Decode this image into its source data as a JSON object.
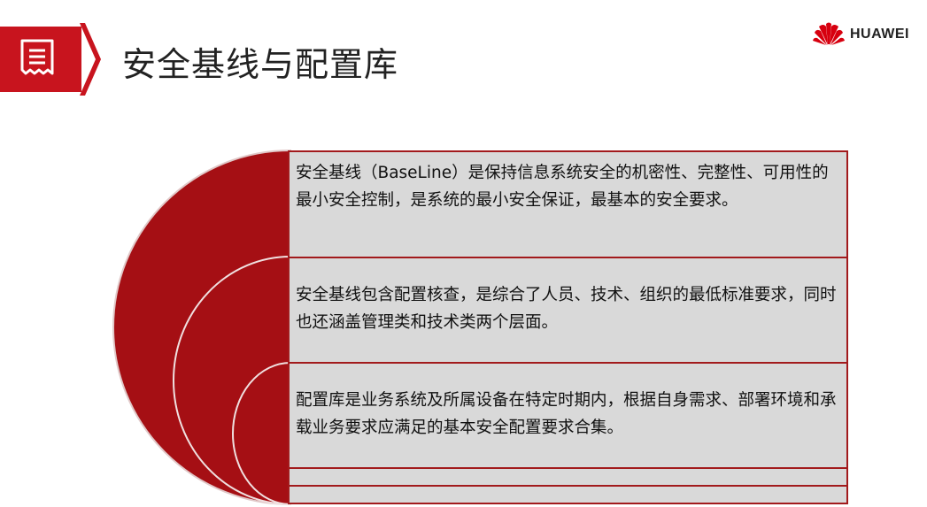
{
  "header": {
    "title": "安全基线与配置库",
    "icon": "document-list-icon",
    "accent_color": "#c8141e"
  },
  "logo": {
    "text": "HUAWEI",
    "color": "#d7000f"
  },
  "panels": [
    {
      "text": "安全基线（BaseLine）是保持信息系统安全的机密性、完整性、可用性的最小安全控制，是系统的最小安全保证，最基本的安全要求。"
    },
    {
      "text": "安全基线包含配置核查，是综合了人员、技术、组织的最低标准要求，同时也还涵盖管理类和技术类两个层面。"
    },
    {
      "text": "配置库是业务系统及所属设备在特定时期内，根据自身需求、部署环境和承载业务要求应满足的基本安全配置要求合集。"
    },
    {
      "text": ""
    },
    {
      "text": ""
    }
  ],
  "colors": {
    "arc_fill": "#a50f14",
    "panel_bg": "#d9d9d9",
    "panel_border": "#a21a1c"
  }
}
